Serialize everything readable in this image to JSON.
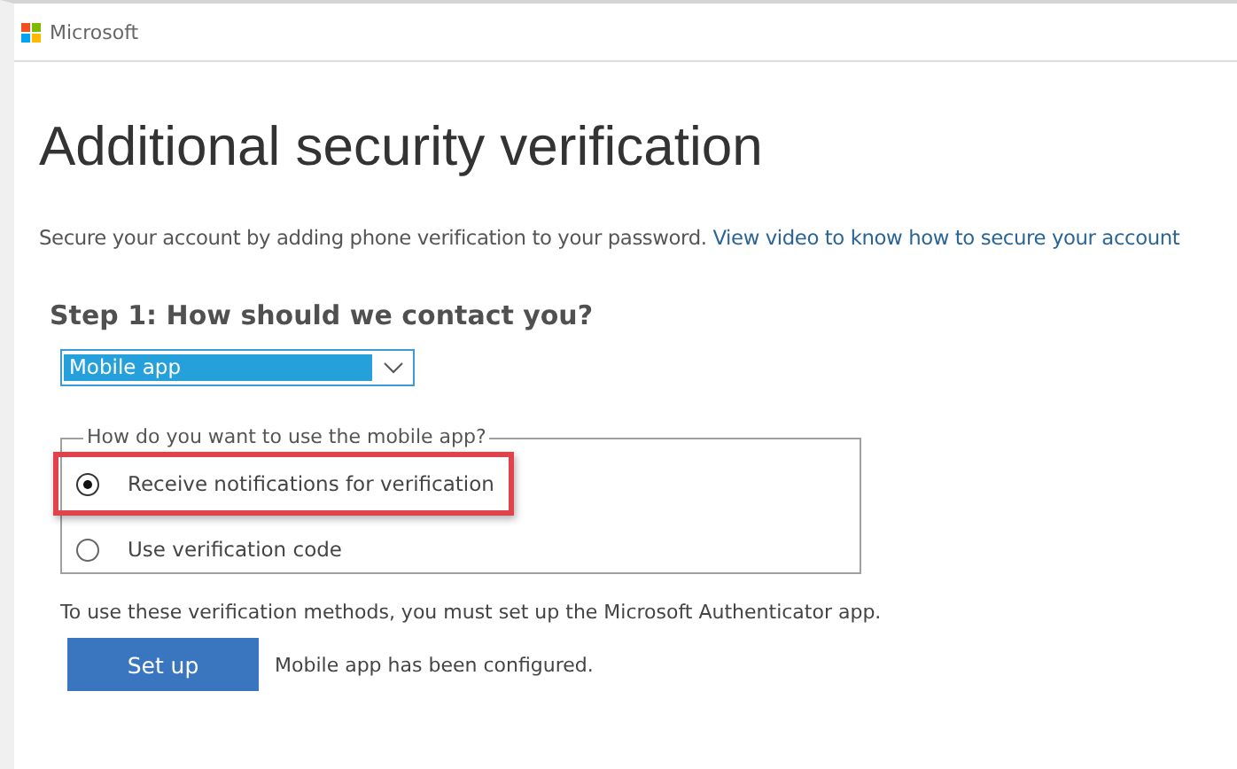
{
  "header": {
    "brand": "Microsoft"
  },
  "title": "Additional security verification",
  "intro": {
    "text": "Secure your account by adding phone verification to your password.",
    "link": "View video to know how to secure your account"
  },
  "step": {
    "heading": "Step 1: How should we contact you?",
    "method": "Mobile app"
  },
  "options": {
    "legend": "How do you want to use the mobile app?",
    "items": [
      {
        "label": "Receive notifications for verification",
        "selected": true,
        "highlighted": true
      },
      {
        "label": "Use verification code",
        "selected": false,
        "highlighted": false
      }
    ]
  },
  "note": "To use these verification methods, you must set up the Microsoft Authenticator app.",
  "setup": {
    "button": "Set up",
    "status": "Mobile app has been configured."
  }
}
